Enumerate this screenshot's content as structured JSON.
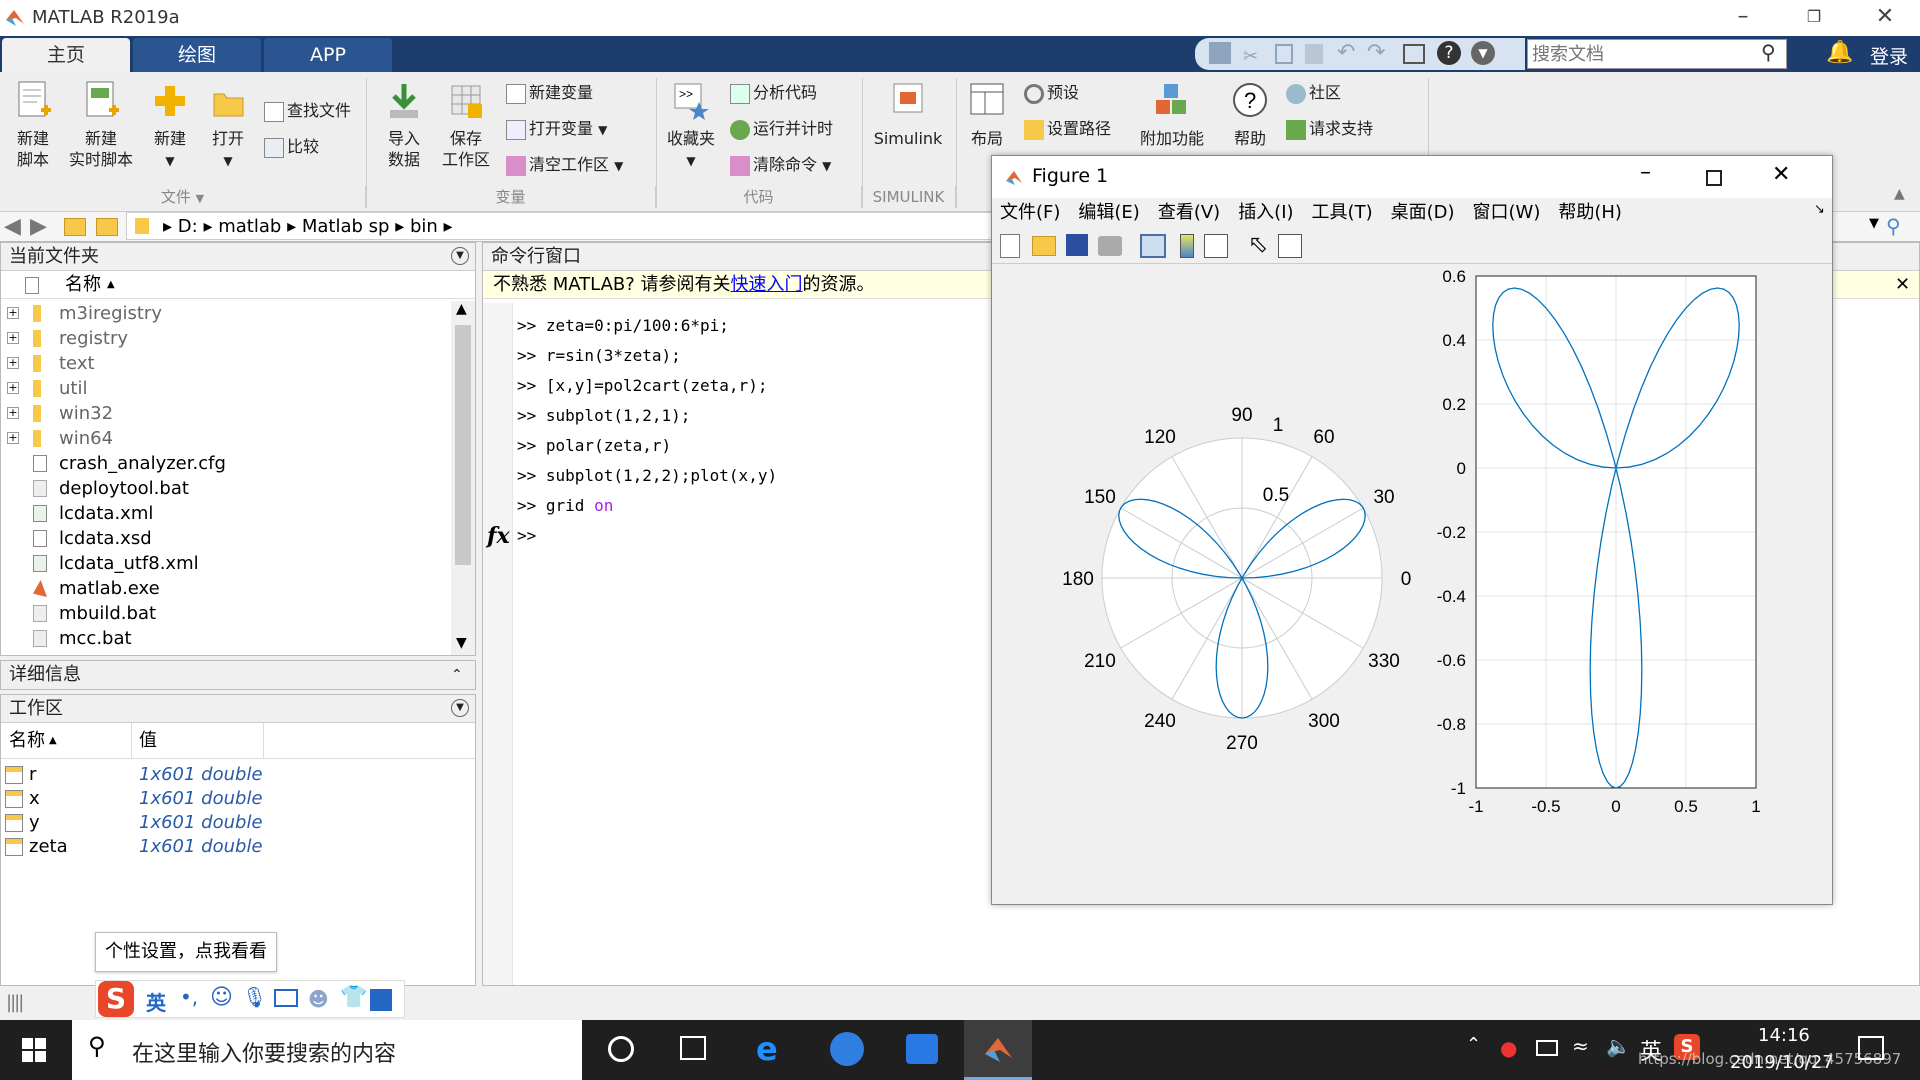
{
  "app": {
    "title": "MATLAB R2019a"
  },
  "tabs": [
    {
      "label": "主页"
    },
    {
      "label": "绘图"
    },
    {
      "label": "APP"
    }
  ],
  "search": {
    "placeholder": "搜索文档"
  },
  "login": "登录",
  "ribbon": {
    "new_script": [
      "新建",
      "脚本"
    ],
    "new_live": [
      "新建",
      "实时脚本"
    ],
    "new": "新建",
    "open": "打开",
    "find_files": "查找文件",
    "compare": "比较",
    "import": [
      "导入",
      "数据"
    ],
    "save_ws": [
      "保存",
      "工作区"
    ],
    "new_var": "新建变量",
    "open_var": "打开变量",
    "clear_ws": "清空工作区",
    "favorites": "收藏夹",
    "analyze": "分析代码",
    "run_time": "运行并计时",
    "clear_cmd": "清除命令",
    "simulink": "Simulink",
    "layout": "布局",
    "prefs": "预设",
    "set_path": "设置路径",
    "addons": "附加功能",
    "help": "帮助",
    "community": "社区",
    "support": "请求支持",
    "groups": {
      "file": "文件",
      "variable": "变量",
      "code": "代码",
      "simulink": "SIMULINK"
    }
  },
  "path": [
    "D:",
    "matlab",
    "Matlab sp",
    "bin"
  ],
  "current_folder": {
    "title": "当前文件夹",
    "col_name": "名称",
    "items": [
      {
        "name": "m3iregistry",
        "type": "folder"
      },
      {
        "name": "registry",
        "type": "folder"
      },
      {
        "name": "text",
        "type": "folder"
      },
      {
        "name": "util",
        "type": "folder"
      },
      {
        "name": "win32",
        "type": "folder"
      },
      {
        "name": "win64",
        "type": "folder"
      },
      {
        "name": "crash_analyzer.cfg",
        "type": "file"
      },
      {
        "name": "deploytool.bat",
        "type": "bat"
      },
      {
        "name": "lcdata.xml",
        "type": "xml"
      },
      {
        "name": "lcdata.xsd",
        "type": "file"
      },
      {
        "name": "lcdata_utf8.xml",
        "type": "xml"
      },
      {
        "name": "matlab.exe",
        "type": "exe"
      },
      {
        "name": "mbuild.bat",
        "type": "bat"
      },
      {
        "name": "mcc.bat",
        "type": "bat"
      }
    ]
  },
  "details": {
    "title": "详细信息"
  },
  "workspace": {
    "title": "工作区",
    "col_name": "名称",
    "col_value": "值",
    "vars": [
      {
        "name": "r",
        "value": "1x601 double"
      },
      {
        "name": "x",
        "value": "1x601 double"
      },
      {
        "name": "y",
        "value": "1x601 double"
      },
      {
        "name": "zeta",
        "value": "1x601 double"
      }
    ]
  },
  "command": {
    "title": "命令行窗口",
    "notice_pre": "不熟悉 MATLAB? 请参阅有关",
    "notice_link": "快速入门",
    "notice_post": "的资源。",
    "lines": [
      ">> zeta=0:pi/100:6*pi;",
      ">> r=sin(3*zeta);",
      ">> [x,y]=pol2cart(zeta,r);",
      ">> subplot(1,2,1);",
      ">> polar(zeta,r)",
      ">> subplot(1,2,2);plot(x,y)",
      ">> grid "
    ],
    "on_word": "on",
    "prompt": ">>",
    "fx": "fx"
  },
  "tooltip": "个性设置，点我看看",
  "ime_lang": "英",
  "figure": {
    "title": "Figure 1",
    "menu": [
      "文件(F)",
      "编辑(E)",
      "查看(V)",
      "插入(I)",
      "工具(T)",
      "桌面(D)",
      "窗口(W)",
      "帮助(H)"
    ]
  },
  "taskbar": {
    "search": "在这里输入你要搜索的内容",
    "time": "14:16",
    "date": "2019/10/27",
    "lang": "英",
    "watermark": "https://blog.csdn.net/qq_45756897"
  },
  "chart_data": [
    {
      "type": "line",
      "subtype": "polar",
      "series": [
        {
          "values": "r = sin(3*theta), theta from 0 to 6*pi"
        }
      ],
      "angle_ticks": [
        "0",
        "30",
        "60",
        "90",
        "120",
        "150",
        "180",
        "210",
        "240",
        "270",
        "300",
        "330"
      ],
      "r_ticks": [
        "0.5",
        "1"
      ],
      "rlim": [
        0,
        1
      ],
      "color": "#0072bd"
    },
    {
      "type": "line",
      "x_ticks": [
        "-1",
        "-0.5",
        "0",
        "0.5",
        "1"
      ],
      "y_ticks": [
        "0.6",
        "0.4",
        "0.2",
        "0",
        "-0.2",
        "-0.4",
        "-0.6",
        "-0.8",
        "-1"
      ],
      "xlim": [
        -1,
        1
      ],
      "ylim": [
        -1,
        0.6
      ],
      "grid": true,
      "series": [
        {
          "values": "x = sin(3t)cos(t), y = sin(3t)sin(t)"
        }
      ],
      "color": "#0072bd"
    }
  ]
}
